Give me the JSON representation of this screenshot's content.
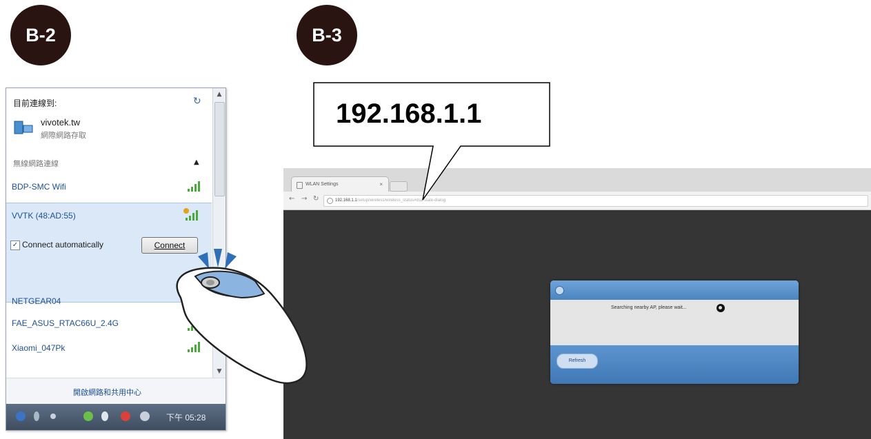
{
  "badges": {
    "left": "B-2",
    "right": "B-3"
  },
  "callout": {
    "ip": "192.168.1.1"
  },
  "wifi_panel": {
    "current_label": "目前連線到:",
    "current_network": "vivotek.tw",
    "current_status": "網際網路存取",
    "section_label": "無線網路連線",
    "networks": [
      {
        "name": "BDP-SMC Wifi"
      },
      {
        "name": "VVTK (48:AD:55)"
      },
      {
        "name": "NETGEAR04"
      },
      {
        "name": "FAE_ASUS_RTAC66U_2.4G"
      },
      {
        "name": "Xiaomi_047Pk"
      }
    ],
    "auto_connect_label": "Connect automatically",
    "connect_button": "Connect",
    "footer_link": "開啟網路和共用中心",
    "taskbar_time": "下午 05:28"
  },
  "browser": {
    "tab_title": "WLAN Settings",
    "tab_close": "×",
    "url_host": "192.168.1.1",
    "url_path": "/setup/wireless/wireless_status#dsa-state-dialog",
    "dialog_message": "Searching nearby AP, please wait...",
    "refresh_button": "Refresh"
  },
  "colors": {
    "badge": "#2a1412",
    "dialog_header": "#4b84c0",
    "selected_item": "#dbe8f7",
    "page_background": "#353535",
    "mouse_highlight": "#8cb4e0",
    "click_marks": "#2f6fb8"
  },
  "icons": [
    "refresh-icon",
    "network-icon",
    "signal-icon",
    "checkbox-icon",
    "spinner-icon",
    "mouse-icon"
  ]
}
